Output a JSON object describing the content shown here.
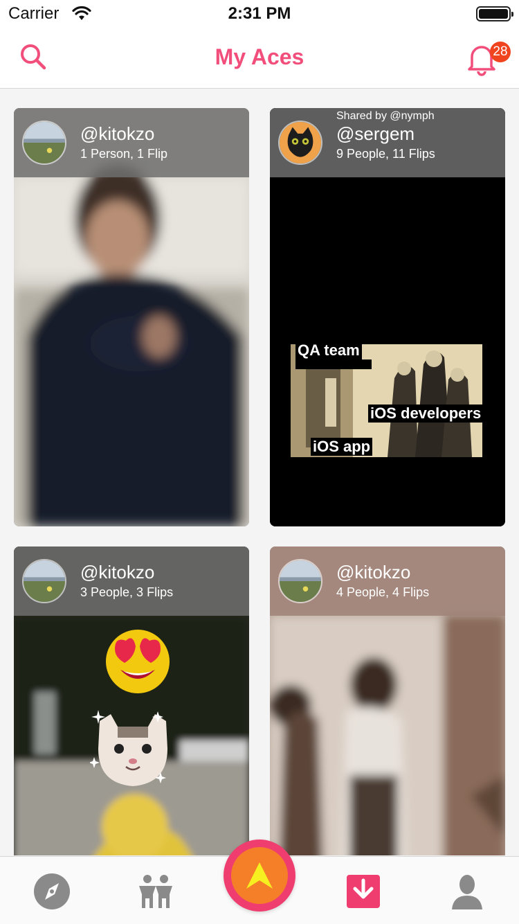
{
  "status_bar": {
    "carrier": "Carrier",
    "time": "2:31 PM"
  },
  "nav": {
    "title": "My Aces",
    "notification_count": "28"
  },
  "colors": {
    "accent": "#f24e7c",
    "badge": "#f0441f",
    "center_button_outer": "#f03d70",
    "center_button_inner": "#f57f29"
  },
  "cards": [
    {
      "handle": "@kitokzo",
      "meta": "1 Person, 1 Flip",
      "shared_by": ""
    },
    {
      "handle": "@sergem",
      "meta": "9 People, 11 Flips",
      "shared_by": "Shared by @nymph",
      "meme": {
        "labels": [
          "QA team",
          "iOS developers",
          "iOS app"
        ]
      }
    },
    {
      "handle": "@kitokzo",
      "meta": "3 People, 3 Flips",
      "shared_by": ""
    },
    {
      "handle": "@kitokzo",
      "meta": "4 People, 4 Flips",
      "shared_by": ""
    }
  ],
  "tabs": [
    {
      "icon": "compass-icon"
    },
    {
      "icon": "people-icon"
    },
    {
      "icon": "ace-arrow-icon"
    },
    {
      "icon": "download-icon"
    },
    {
      "icon": "profile-icon"
    }
  ]
}
